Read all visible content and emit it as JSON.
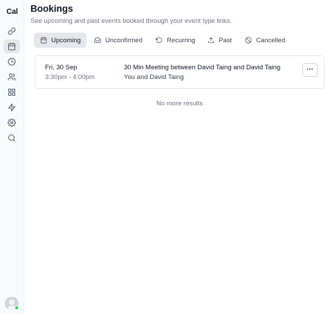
{
  "sidebar": {
    "logo": "Cal",
    "items": [
      {
        "name": "event-types",
        "icon": "link-icon",
        "active": false
      },
      {
        "name": "bookings",
        "icon": "calendar-icon",
        "active": true
      },
      {
        "name": "availability",
        "icon": "clock-icon",
        "active": false
      },
      {
        "name": "teams",
        "icon": "users-icon",
        "active": false
      },
      {
        "name": "apps",
        "icon": "grid-icon",
        "active": false
      },
      {
        "name": "workflows",
        "icon": "zap-icon",
        "active": false
      },
      {
        "name": "settings",
        "icon": "gear-icon",
        "active": false
      },
      {
        "name": "search",
        "icon": "search-icon",
        "active": false
      }
    ],
    "status_color": "#22c55e"
  },
  "header": {
    "title": "Bookings",
    "subtitle": "See upcoming and past events booked through your event type links."
  },
  "tabs": [
    {
      "label": "Upcoming",
      "icon": "calendar-icon",
      "active": true
    },
    {
      "label": "Unconfirmed",
      "icon": "inbox-icon",
      "active": false
    },
    {
      "label": "Recurring",
      "icon": "refresh-icon",
      "active": false
    },
    {
      "label": "Past",
      "icon": "upload-icon",
      "active": false
    },
    {
      "label": "Cancelled",
      "icon": "ban-icon",
      "active": false
    }
  ],
  "bookings": [
    {
      "date": "Fri, 30 Sep",
      "time": "3:30pm - 4:00pm",
      "title": "30 Min Meeting between David Taing and David Taing",
      "attendees": "You and David Taing",
      "more_label": "···"
    }
  ],
  "empty_message": "No more results"
}
